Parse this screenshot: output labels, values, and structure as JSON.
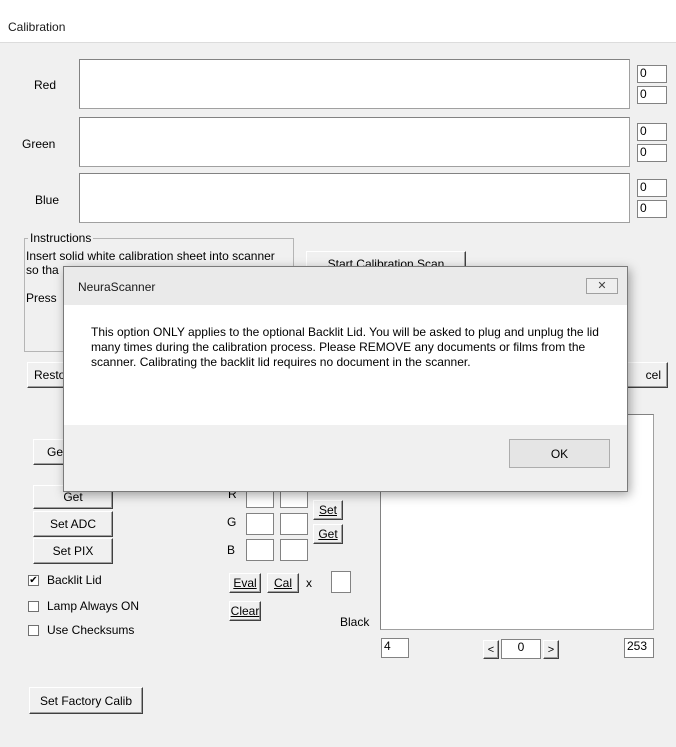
{
  "window": {
    "title": "Calibration"
  },
  "channels": [
    {
      "label": "Red",
      "val1": "0",
      "val2": "0"
    },
    {
      "label": "Green",
      "val1": "0",
      "val2": "0"
    },
    {
      "label": "Blue",
      "val1": "0",
      "val2": "0"
    }
  ],
  "instructions": {
    "title": "Instructions",
    "line1": "Insert solid white calibration sheet into scanner",
    "line2": "so tha",
    "line3": "Press"
  },
  "buttons": {
    "start_scan": "Start Calibration Scan",
    "restore_partial": "Resto",
    "cancel_partial": "cel",
    "get_top_partial": "Get",
    "get": "Get",
    "set_adc": "Set ADC",
    "set_pix": "Set PIX",
    "set_small": "Set",
    "get_small": "Get",
    "eval": "Eval",
    "cal": "Cal",
    "clear": "Clear",
    "set_factory": "Set Factory Calib",
    "scroll_left": "<",
    "scroll_right": ">"
  },
  "rgb_labels": {
    "r": "R",
    "g": "G",
    "b": "B",
    "x": "x"
  },
  "checkboxes": [
    {
      "label": "Backlit Lid",
      "checked": true
    },
    {
      "label": "Lamp Always ON",
      "checked": false
    },
    {
      "label": "Use Checksums",
      "checked": false
    }
  ],
  "histogram": {
    "black_label": "Black",
    "low_value": "4",
    "mid_value": "0",
    "high_value": "253"
  },
  "dialog": {
    "title": "NeuraScanner",
    "close_glyph": "✕",
    "message": "This option ONLY applies to the optional Backlit Lid.  You will be asked to plug and unplug the lid many times during the calibration process.  Please REMOVE any documents or films from the scanner.  Calibrating the backlit lid requires no document in the scanner.",
    "ok_label": "OK"
  }
}
